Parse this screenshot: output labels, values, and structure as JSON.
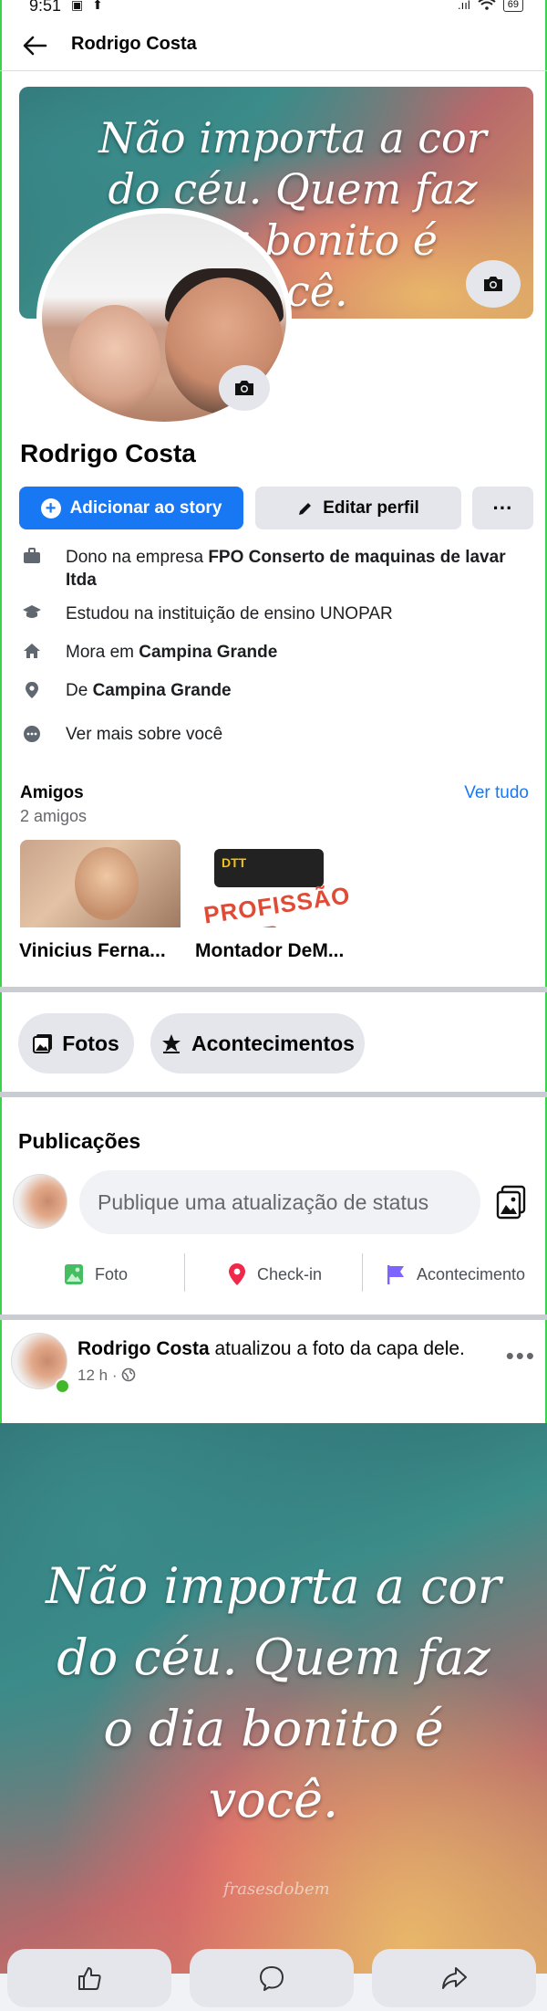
{
  "status_bar": {
    "time": "9:51",
    "left_icons": "▣ ⬆",
    "signal": ".ııl",
    "wifi": "wifi-icon",
    "battery": "69"
  },
  "header": {
    "title": "Rodrigo Costa",
    "back_icon": "arrow-left-icon"
  },
  "cover": {
    "quote": "Não importa a cor do céu. Quem faz o dia bonito é você."
  },
  "profile": {
    "name": "Rodrigo Costa"
  },
  "actions": {
    "add_story": "Adicionar ao story",
    "edit_profile": "Editar perfil",
    "more": "···"
  },
  "about": [
    {
      "icon": "briefcase-icon",
      "prefix": "Dono na empresa ",
      "bold": "FPO Conserto de maquinas de lavar Itda"
    },
    {
      "icon": "graduation-cap-icon",
      "prefix": "Estudou na instituição de ensino UNOPAR",
      "bold": ""
    },
    {
      "icon": "home-icon",
      "prefix": "Mora em ",
      "bold": "Campina Grande"
    },
    {
      "icon": "location-pin-icon",
      "prefix": "De ",
      "bold": "Campina Grande"
    },
    {
      "icon": "more-circle-icon",
      "prefix": "Ver mais sobre você",
      "bold": ""
    }
  ],
  "friends": {
    "title": "Amigos",
    "count": "2 amigos",
    "see_all": "Ver tudo",
    "items": [
      {
        "name": "Vinicius Ferna..."
      },
      {
        "name": "Montador DeM...",
        "thumb_tag": "DTT",
        "thumb_text": "PROFISSÃO ADOR"
      }
    ]
  },
  "chips": {
    "photos": "Fotos",
    "events": "Acontecimentos"
  },
  "publications": {
    "title": "Publicações",
    "composer_placeholder": "Publique uma atualização de status",
    "quick_actions": [
      "Foto",
      "Check-in",
      "Acontecimento"
    ]
  },
  "post": {
    "author": "Rodrigo Costa",
    "action": " atualizou a foto da capa dele.",
    "time": "12 h",
    "sep": "·",
    "more": "•••",
    "image_quote": "Não importa a cor do céu. Quem faz o dia bonito é você.",
    "watermark": "frasesdobem"
  },
  "colors": {
    "brand": "#1877f2",
    "online": "#42b72a"
  }
}
